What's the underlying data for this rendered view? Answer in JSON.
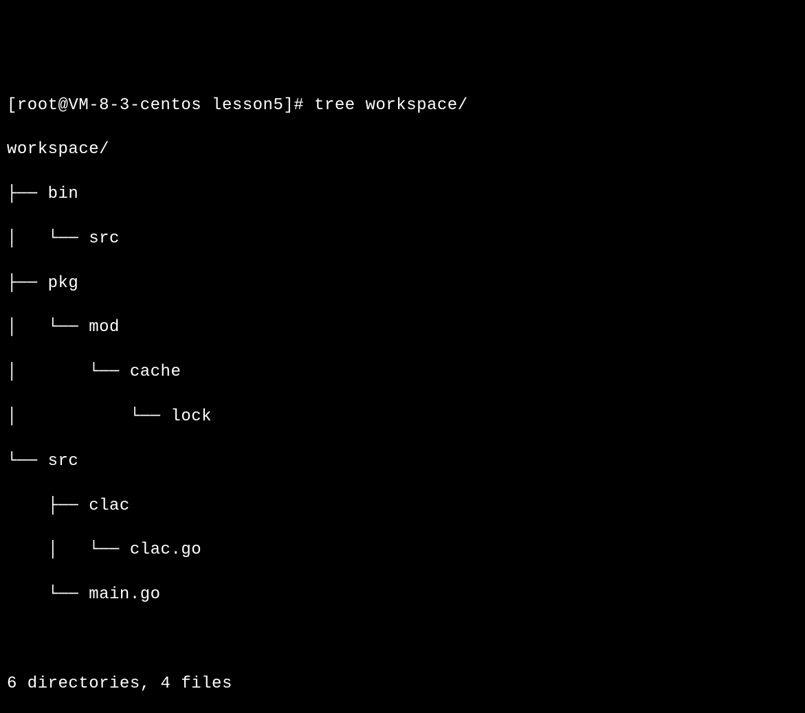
{
  "prompt": {
    "user_host": "[root@VM-8-3-centos lesson5]#",
    "command": "tree workspace/"
  },
  "tree": {
    "root": "workspace/",
    "lines": [
      "├── bin",
      "│   └── src",
      "├── pkg",
      "│   └── mod",
      "│       └── cache",
      "│           └── lock",
      "└── src",
      "    ├── clac",
      "    │   └── clac.go",
      "    └── main.go"
    ]
  },
  "summary": "6 directories, 4 files"
}
